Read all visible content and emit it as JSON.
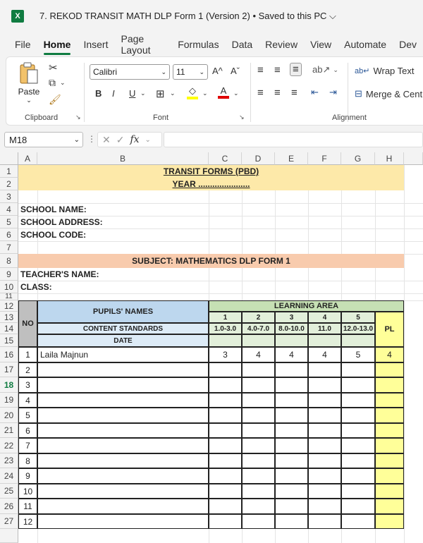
{
  "app": {
    "logo": "X",
    "title": "7. REKOD TRANSIT MATH DLP Form 1 (Version 2) • Saved to this PC ⌵"
  },
  "menu": [
    "File",
    "Home",
    "Insert",
    "Page Layout",
    "Formulas",
    "Data",
    "Review",
    "View",
    "Automate",
    "Dev"
  ],
  "ribbon": {
    "paste": "Paste",
    "clipboard_label": "Clipboard",
    "font_name": "Calibri",
    "font_size": "11",
    "font_label": "Font",
    "alignment_label": "Alignment",
    "wrap_text": "Wrap Text",
    "merge_center": "Merge & Cent",
    "bold": "B",
    "italic": "I",
    "underline": "U",
    "grow": "A^",
    "shrink": "Aˇ"
  },
  "formula_bar": {
    "name_box": "M18",
    "fx": "fx"
  },
  "columns": [
    "A",
    "B",
    "C",
    "D",
    "E",
    "F",
    "G",
    "H"
  ],
  "rows": [
    "1",
    "2",
    "3",
    "4",
    "5",
    "6",
    "7",
    "8",
    "9",
    "10",
    "11",
    "12",
    "13",
    "14",
    "15",
    "16",
    "17",
    "18",
    "19",
    "20",
    "21",
    "22",
    "23",
    "24",
    "25",
    "26",
    "27"
  ],
  "form": {
    "title1": "TRANSIT FORMS (PBD)",
    "title2": "YEAR ......................",
    "school_name": "SCHOOL NAME:",
    "school_address": "SCHOOL ADDRESS:",
    "school_code": "SCHOOL CODE:",
    "subject": "SUBJECT: MATHEMATICS DLP FORM 1",
    "teacher": "TEACHER'S NAME:",
    "class": "CLASS:",
    "no": "NO",
    "pupils_names": "PUPILS' NAMES",
    "content_standards": "CONTENT STANDARDS",
    "date": "DATE",
    "learning_area": "LEARNING AREA",
    "pl": "PL",
    "areas": [
      {
        "num": "1",
        "range": "1.0-3.0"
      },
      {
        "num": "2",
        "range": "4.0-7.0"
      },
      {
        "num": "3",
        "range": "8.0-10.0"
      },
      {
        "num": "4",
        "range": "11.0"
      },
      {
        "num": "5",
        "range": "12.0-13.0"
      }
    ],
    "pupils": [
      {
        "no": "1",
        "name": "Laila Majnun",
        "scores": [
          "3",
          "4",
          "4",
          "4",
          "5"
        ],
        "pl": "4"
      },
      {
        "no": "2"
      },
      {
        "no": "3"
      },
      {
        "no": "4"
      },
      {
        "no": "5"
      },
      {
        "no": "6"
      },
      {
        "no": "7"
      },
      {
        "no": "8"
      },
      {
        "no": "9"
      },
      {
        "no": "10"
      },
      {
        "no": "11"
      },
      {
        "no": "12"
      }
    ]
  },
  "colors": {
    "accent": "#107c41",
    "title_band": "#fde9a9",
    "subject_band": "#f8cbad",
    "names_header": "#bdd7ee",
    "learning_header": "#c6e0b4",
    "pl_fill": "#ffff99"
  }
}
